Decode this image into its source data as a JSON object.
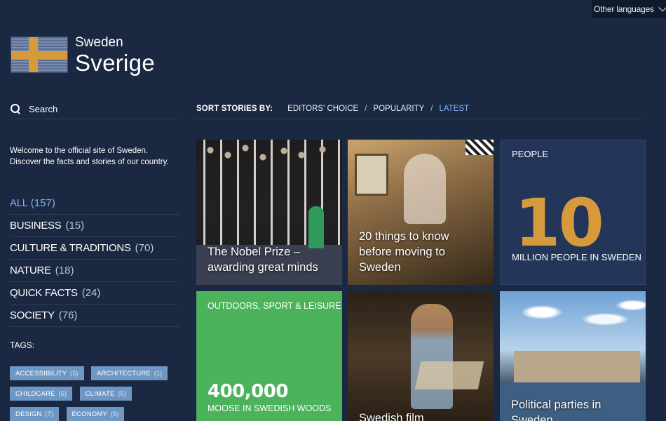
{
  "header": {
    "other_languages": "Other languages"
  },
  "logo": {
    "english": "Sweden",
    "swedish": "Sverige"
  },
  "search": {
    "label": "Search"
  },
  "welcome": "Welcome to the official site of Sweden. Discover the facts and stories of our country.",
  "categories": [
    {
      "name": "ALL",
      "count": "(157)",
      "active": true
    },
    {
      "name": "BUSINESS",
      "count": "(15)"
    },
    {
      "name": "CULTURE & TRADITIONS",
      "count": "(70)"
    },
    {
      "name": "NATURE",
      "count": "(18)"
    },
    {
      "name": "QUICK FACTS",
      "count": "(24)"
    },
    {
      "name": "SOCIETY",
      "count": "(76)"
    }
  ],
  "tags_title": "TAGS:",
  "tags": [
    {
      "name": "ACCESSIBILITY",
      "count": "(5)"
    },
    {
      "name": "ARCHITECTURE",
      "count": "(1)"
    },
    {
      "name": "CHILDCARE",
      "count": "(5)"
    },
    {
      "name": "CLIMATE",
      "count": "(5)"
    },
    {
      "name": "DESIGN",
      "count": "(7)"
    },
    {
      "name": "ECONOMY",
      "count": "(5)"
    }
  ],
  "sort": {
    "label": "SORT STORIES BY:",
    "options": [
      "EDITORS' CHOICE",
      "POPULARITY",
      "LATEST"
    ],
    "separator": "/"
  },
  "cards": {
    "nobel": {
      "title": "The Nobel Prize – awarding great minds"
    },
    "moving": {
      "title": "20 things to know before moving to Sweden"
    },
    "people": {
      "category": "PEOPLE",
      "number": "10",
      "caption": "MILLION PEOPLE IN SWEDEN"
    },
    "outdoors": {
      "category": "OUTDOORS, SPORT & LEISURE",
      "number": "400,000",
      "caption": "MOOSE IN SWEDISH WOODS"
    },
    "film": {
      "title": "Swedish film"
    },
    "politics": {
      "title": "Political parties in Sweden"
    }
  },
  "colors": {
    "background": "#1a2842",
    "accent_blue": "#7fb3ee",
    "flag_gold": "#d69a3c",
    "tag_bg": "#6f97c3",
    "green_card": "#4cb35a"
  }
}
